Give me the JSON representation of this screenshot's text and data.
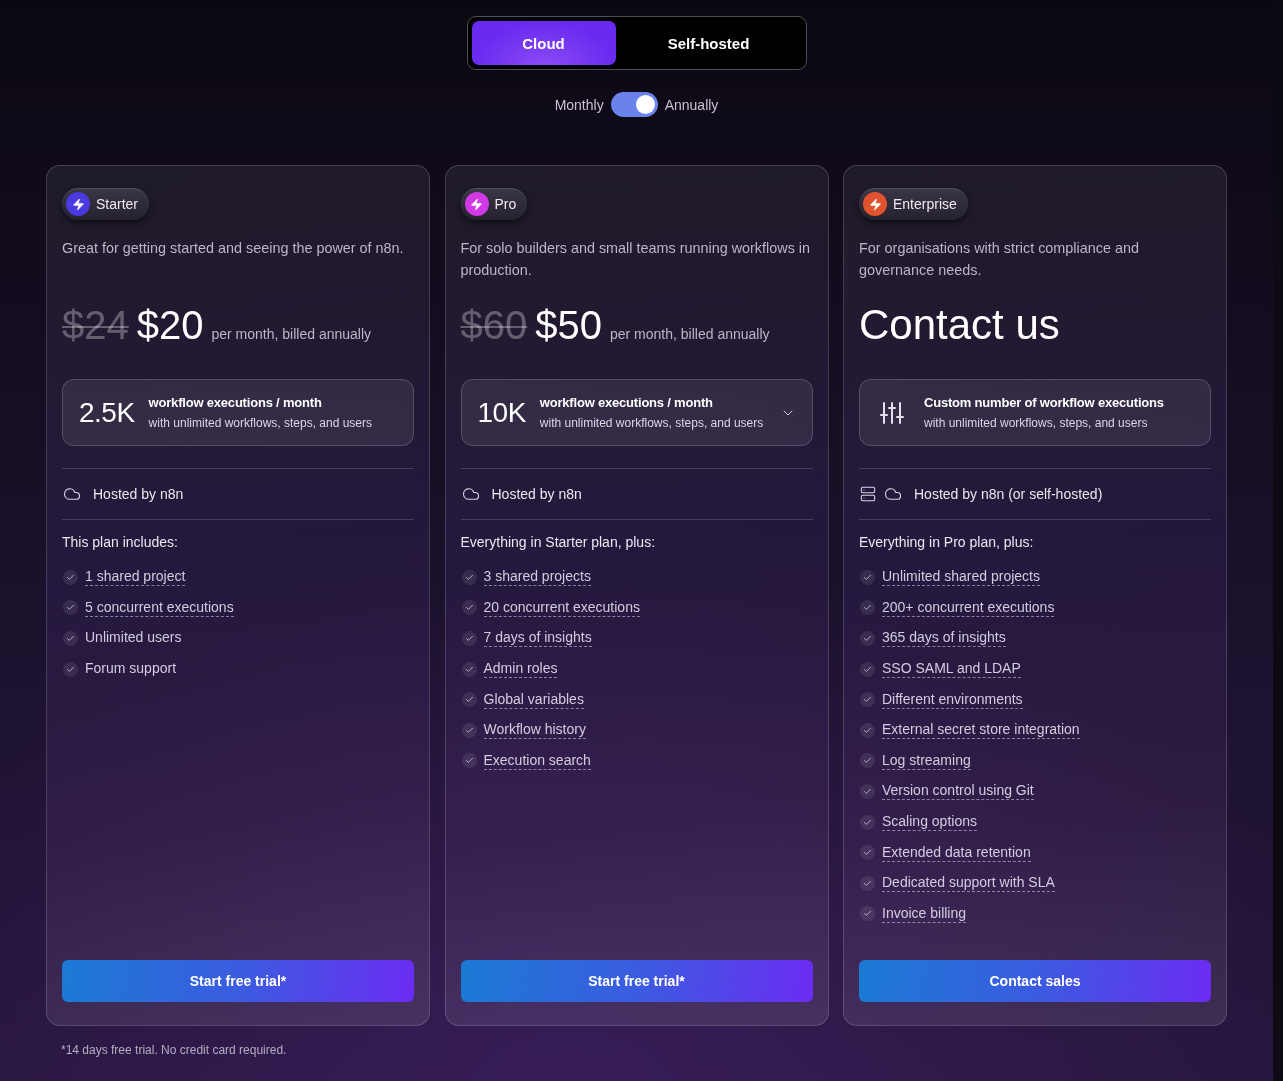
{
  "deployment_tabs": [
    {
      "label": "Cloud",
      "selected": true
    },
    {
      "label": "Self-hosted",
      "selected": false
    }
  ],
  "billing_toggle": {
    "left_label": "Monthly",
    "right_label": "Annually",
    "on": true
  },
  "plans": [
    {
      "name": "Starter",
      "color": "#4a3be0",
      "description": "Great for getting started and seeing the power of n8n.",
      "price": {
        "kind": "amount",
        "old": "$24",
        "current": "$20",
        "period": "per month, billed annually"
      },
      "executions": {
        "kind": "count",
        "amount": "2.5K",
        "title": "workflow executions / month",
        "subtitle": "with unlimited workflows, steps, and users",
        "expandable": false
      },
      "hosting": {
        "label": "Hosted by n8n",
        "self_hosted_option": false
      },
      "includes_heading": "This plan includes:",
      "features": [
        {
          "label": "1 shared project",
          "tooltip": true
        },
        {
          "label": "5 concurrent executions",
          "tooltip": true
        },
        {
          "label": "Unlimited users",
          "tooltip": false
        },
        {
          "label": "Forum support",
          "tooltip": false
        }
      ],
      "cta": "Start free trial*"
    },
    {
      "name": "Pro",
      "color": "#d03ae4",
      "description": "For solo builders and small teams running workflows in production.",
      "price": {
        "kind": "amount",
        "old": "$60",
        "current": "$50",
        "period": "per month, billed annually"
      },
      "executions": {
        "kind": "count",
        "amount": "10K",
        "title": "workflow executions / month",
        "subtitle": "with unlimited workflows, steps, and users",
        "expandable": true
      },
      "hosting": {
        "label": "Hosted by n8n",
        "self_hosted_option": false
      },
      "includes_heading": "Everything in Starter plan, plus:",
      "features": [
        {
          "label": "3 shared projects",
          "tooltip": true
        },
        {
          "label": "20 concurrent executions",
          "tooltip": true
        },
        {
          "label": "7 days of insights",
          "tooltip": true
        },
        {
          "label": "Admin roles",
          "tooltip": true
        },
        {
          "label": "Global variables",
          "tooltip": true
        },
        {
          "label": "Workflow history",
          "tooltip": true
        },
        {
          "label": "Execution search",
          "tooltip": true
        }
      ],
      "cta": "Start free trial*"
    },
    {
      "name": "Enterprise",
      "color": "#e0532e",
      "description": "For organisations with strict compliance and governance needs.",
      "price": {
        "kind": "contact",
        "label": "Contact us"
      },
      "executions": {
        "kind": "custom",
        "title": "Custom number of workflow executions",
        "subtitle": "with unlimited workflows, steps, and users",
        "expandable": false
      },
      "hosting": {
        "label": "Hosted by n8n (or self-hosted)",
        "self_hosted_option": true
      },
      "includes_heading": "Everything in Pro plan, plus:",
      "features": [
        {
          "label": "Unlimited shared projects",
          "tooltip": true
        },
        {
          "label": "200+ concurrent executions",
          "tooltip": true
        },
        {
          "label": "365 days of insights",
          "tooltip": true
        },
        {
          "label": "SSO SAML and LDAP",
          "tooltip": true
        },
        {
          "label": "Different environments",
          "tooltip": true
        },
        {
          "label": "External secret store integration",
          "tooltip": true
        },
        {
          "label": "Log streaming",
          "tooltip": true
        },
        {
          "label": "Version control using Git",
          "tooltip": true
        },
        {
          "label": "Scaling options",
          "tooltip": true
        },
        {
          "label": "Extended data retention",
          "tooltip": true
        },
        {
          "label": "Dedicated support with SLA",
          "tooltip": true
        },
        {
          "label": "Invoice billing",
          "tooltip": true
        }
      ],
      "cta": "Contact sales"
    }
  ],
  "footnote": "*14 days free trial. No credit card required."
}
